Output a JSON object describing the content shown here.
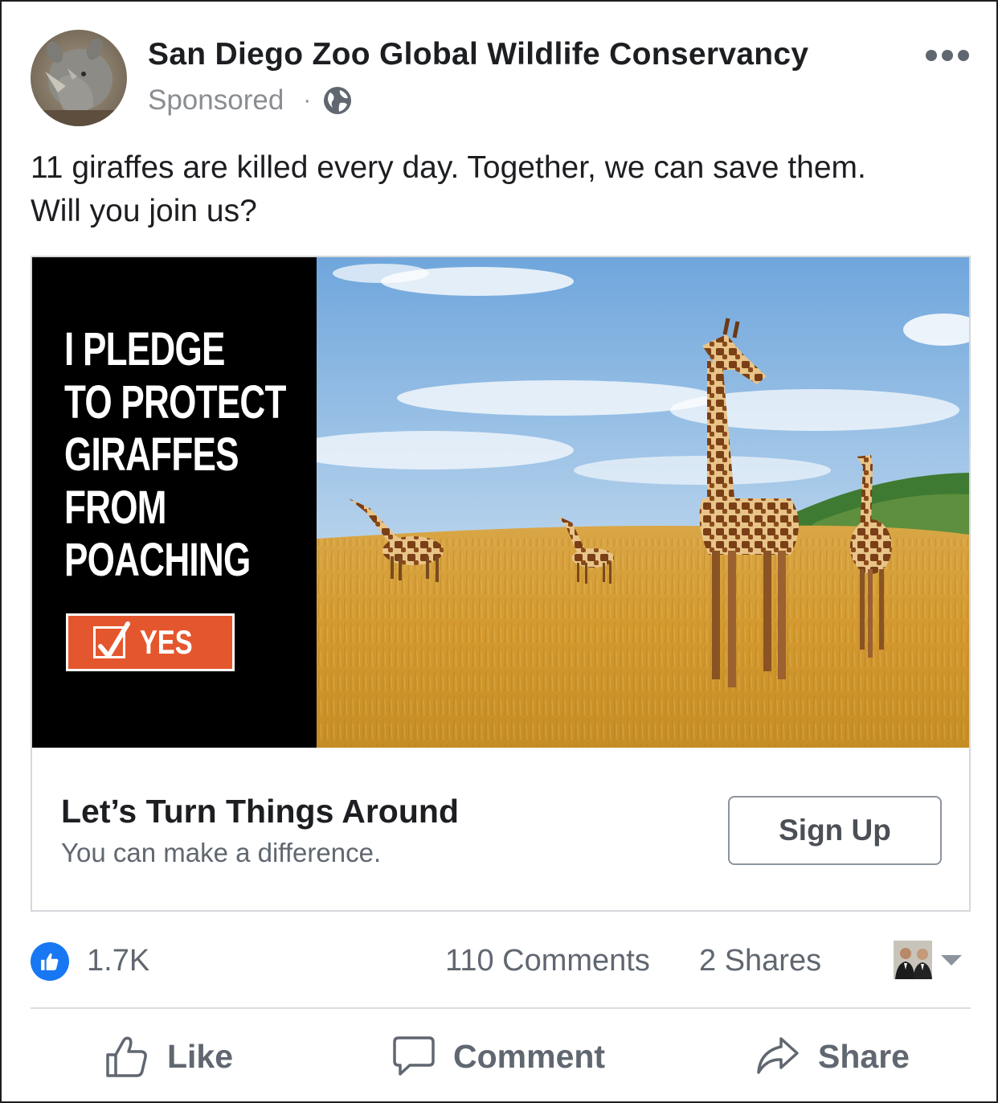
{
  "post": {
    "page_name": "San Diego Zoo Global Wildlife Conservancy",
    "sponsored_label": "Sponsored",
    "separator": "·",
    "privacy_icon": "globe-icon",
    "more_icon": "more-options-icon",
    "text_line1": "11 giraffes are killed every day. Together, we can save them.",
    "text_line2": "Will you join us?"
  },
  "ad": {
    "pledge_lines": [
      "I PLEDGE",
      "TO PROTECT",
      "GIRAFFES",
      "FROM",
      "POACHING"
    ],
    "yes_label": "YES",
    "headline": "Let’s Turn Things Around",
    "description": "You can make a difference.",
    "cta_label": "Sign Up",
    "accent_color": "#e4572e"
  },
  "stats": {
    "reactions": "1.7K",
    "comments": "110 Comments",
    "shares": "2 Shares",
    "reaction_icon": "thumbs-up-icon"
  },
  "actions": [
    {
      "label": "Like",
      "icon": "like-icon"
    },
    {
      "label": "Comment",
      "icon": "comment-icon"
    },
    {
      "label": "Share",
      "icon": "share-icon"
    }
  ],
  "colors": {
    "brand_blue": "#1877f2",
    "secondary_text": "#606770",
    "primary_text": "#1c1e21"
  }
}
